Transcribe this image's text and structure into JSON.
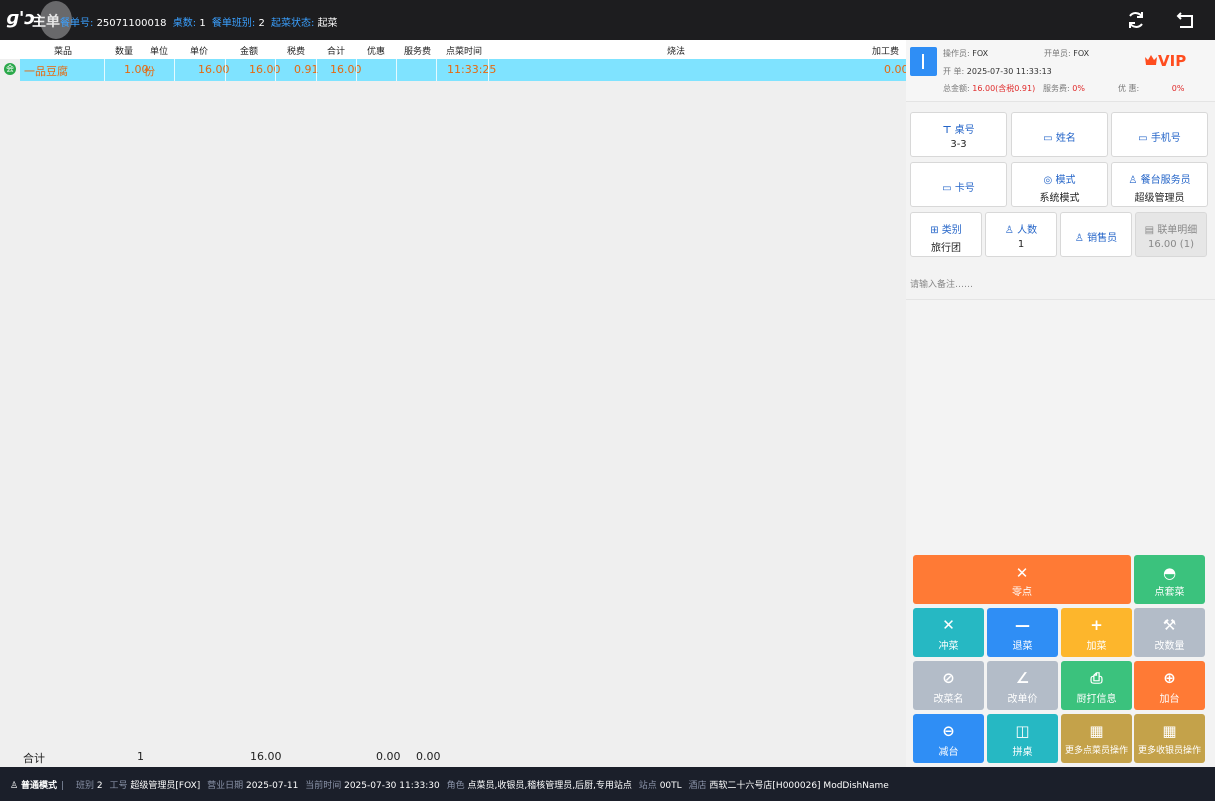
{
  "topbar": {
    "logo": "ɡ'ɔ",
    "title": "主单",
    "bill_no_label": "餐单号:",
    "bill_no": "25071100018",
    "tables_label": "桌数:",
    "tables": "1",
    "shift_label": "餐单班别:",
    "shift": "2",
    "serve_status_label": "起菜状态:",
    "serve_status": "起菜",
    "refresh_icon": "refresh-icon",
    "back_icon": "back-icon"
  },
  "list": {
    "headers": [
      "菜品",
      "数量",
      "单位",
      "单价",
      "金额",
      "税费",
      "合计",
      "优惠",
      "服务费",
      "点菜时间",
      "烧法",
      "加工费"
    ],
    "rows": [
      {
        "badge": "会",
        "dish": "一品豆腐",
        "qty": "1.00",
        "unit": "份",
        "price": "16.00",
        "amount": "16.00",
        "tax": "0.91",
        "total": "16.00",
        "discount": "",
        "service": "",
        "time": "11:33:25",
        "cooking": "",
        "process_fee": "0.00"
      }
    ],
    "totals": {
      "label": "合计",
      "qty": "1",
      "amount": "16.00",
      "discount": "0.00",
      "service": "0.00"
    }
  },
  "info": {
    "operator_label": "操作员:",
    "operator": "FOX",
    "opener_label": "开单员:",
    "opener": "FOX",
    "open_label": "开  单:",
    "open_time": "2025-07-30 11:33:13",
    "total_label": "总金额:",
    "total": "16.00(含税0.91)",
    "service_label": "服务费:",
    "service": "0%",
    "discount_label": "优  惠:",
    "discount": "0%",
    "vip": "VIP"
  },
  "info_buttons": {
    "table_label": "桌号",
    "table_value": "3-3",
    "name_label": "姓名",
    "phone_label": "手机号",
    "card_label": "卡号",
    "mode_label": "模式",
    "mode_value": "系统模式",
    "waiter_label": "餐台服务员",
    "waiter_value": "超级管理员",
    "category_label": "类别",
    "category_value": "旅行团",
    "people_label": "人数",
    "people_value": "1",
    "sales_label": "销售员",
    "linked_label": "联单明细",
    "linked_value": "16.00 (1)"
  },
  "remark_placeholder": "请输入备注……",
  "actions": {
    "single_order": "零点",
    "set_menu": "点套菜",
    "rush": "冲菜",
    "return": "退菜",
    "add": "加菜",
    "change_qty": "改数量",
    "rename": "改菜名",
    "change_price": "改单价",
    "kitchen_print": "厨打信息",
    "add_table": "加台",
    "reduce_table": "减台",
    "merge_table": "拼桌",
    "more_order_ops": "更多点菜员操作",
    "more_cashier_ops": "更多收银员操作"
  },
  "colors": {
    "orange": "#ff7a35",
    "green": "#3bc27d",
    "teal": "#26b8c3",
    "blue": "#2f8ef5",
    "yellow": "#fdb62c",
    "grey": "#b3bcc8",
    "gold": "#c4a24a",
    "row_highlight": "#7fe3ff"
  },
  "status": {
    "mode": "普通模式",
    "shift_label": "班别",
    "shift": "2",
    "worker_label": "工号",
    "worker": "超级管理员[FOX]",
    "bizdate_label": "营业日期",
    "bizdate": "2025-07-11",
    "now_label": "当前时间",
    "now": "2025-07-30 11:33:30",
    "role_label": "角色",
    "role": "点菜员,收银员,稽核管理员,后厨,专用站点",
    "station_label": "站点",
    "station": "00TL",
    "hotel_label": "酒店",
    "hotel": "西软二十六号店[H000026] ModDishName"
  }
}
